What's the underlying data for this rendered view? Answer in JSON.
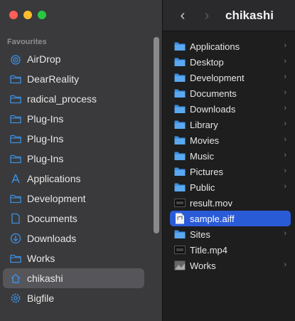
{
  "sidebar": {
    "section_title": "Favourites",
    "items": [
      {
        "label": "AirDrop",
        "icon": "airdrop-icon"
      },
      {
        "label": "DearReality",
        "icon": "folder-icon"
      },
      {
        "label": "radical_process",
        "icon": "folder-icon"
      },
      {
        "label": "Plug-Ins",
        "icon": "folder-icon"
      },
      {
        "label": "Plug-Ins",
        "icon": "folder-icon"
      },
      {
        "label": "Plug-Ins",
        "icon": "folder-icon"
      },
      {
        "label": "Applications",
        "icon": "applications-icon"
      },
      {
        "label": "Development",
        "icon": "folder-icon"
      },
      {
        "label": "Documents",
        "icon": "document-icon"
      },
      {
        "label": "Downloads",
        "icon": "download-icon"
      },
      {
        "label": "Works",
        "icon": "folder-icon"
      },
      {
        "label": "chikashi",
        "icon": "home-icon",
        "selected": true
      },
      {
        "label": "Bigfile",
        "icon": "gear-icon"
      }
    ]
  },
  "toolbar": {
    "title": "chikashi"
  },
  "files": [
    {
      "name": "Applications",
      "type": "folder",
      "expandable": true
    },
    {
      "name": "Desktop",
      "type": "folder",
      "expandable": true
    },
    {
      "name": "Development",
      "type": "folder",
      "expandable": true
    },
    {
      "name": "Documents",
      "type": "folder",
      "expandable": true
    },
    {
      "name": "Downloads",
      "type": "folder",
      "expandable": true
    },
    {
      "name": "Library",
      "type": "folder",
      "expandable": true
    },
    {
      "name": "Movies",
      "type": "folder",
      "expandable": true
    },
    {
      "name": "Music",
      "type": "folder",
      "expandable": true
    },
    {
      "name": "Pictures",
      "type": "folder",
      "expandable": true
    },
    {
      "name": "Public",
      "type": "folder",
      "expandable": true
    },
    {
      "name": "result.mov",
      "type": "video",
      "expandable": false
    },
    {
      "name": "sample.aiff",
      "type": "audio",
      "expandable": false,
      "selected": true
    },
    {
      "name": "Sites",
      "type": "folder",
      "expandable": true
    },
    {
      "name": "Title.mp4",
      "type": "video",
      "expandable": false
    },
    {
      "name": "Works",
      "type": "image",
      "expandable": true
    }
  ],
  "colors": {
    "accent": "#2a5bd7",
    "folder": "#3d8fe0",
    "sidebar_bg": "#3a3a3c",
    "main_bg": "#1e1e1e"
  }
}
